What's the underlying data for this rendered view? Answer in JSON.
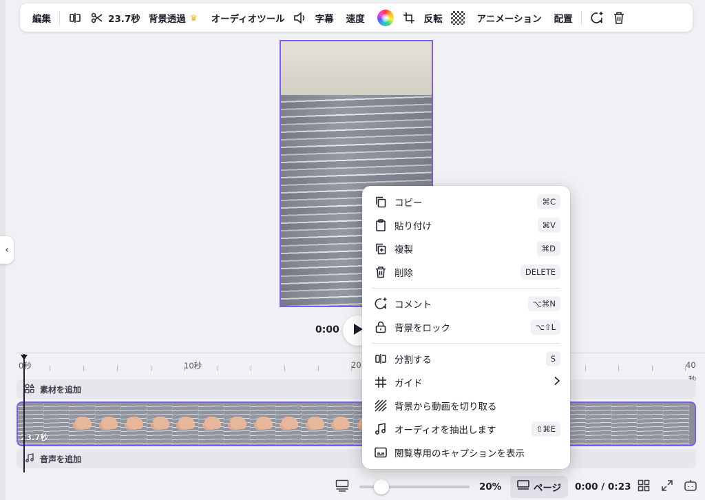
{
  "toolbar": {
    "edit": "編集",
    "duration": "23.7秒",
    "bg_remove": "背景透過",
    "audio_tools": "オーディオツール",
    "captions": "字幕",
    "speed": "速度",
    "flip": "反転",
    "animation": "アニメーション",
    "arrange": "配置"
  },
  "playback": {
    "current_time": "0:00"
  },
  "timeline": {
    "ruler": [
      "0秒",
      "10秒",
      "20",
      "40",
      "秒"
    ],
    "add_element": "素材を追加",
    "add_audio": "音声を追加",
    "clip_duration": "23.7秒"
  },
  "bottom": {
    "zoom": "20%",
    "zoom_fraction": 0.2,
    "page": "ページ",
    "time": "0:00 / 0:23"
  },
  "context_menu": {
    "copy": {
      "label": "コピー",
      "shortcut": "⌘C"
    },
    "paste": {
      "label": "貼り付け",
      "shortcut": "⌘V"
    },
    "duplicate": {
      "label": "複製",
      "shortcut": "⌘D"
    },
    "delete": {
      "label": "削除",
      "shortcut": "DELETE"
    },
    "comment": {
      "label": "コメント",
      "shortcut": "⌥⌘N"
    },
    "lock_bg": {
      "label": "背景をロック",
      "shortcut": "⌥⇧L"
    },
    "split": {
      "label": "分割する",
      "shortcut": "S"
    },
    "guide": {
      "label": "ガイド"
    },
    "cut_from_bg": {
      "label": "背景から動画を切り取る"
    },
    "extract_audio": {
      "label": "オーディオを抽出します",
      "shortcut": "⇧⌘E"
    },
    "show_captions": {
      "label": "閲覧専用のキャプションを表示"
    }
  },
  "colors": {
    "accent": "#7d5cf3",
    "background": "#f0f1f4"
  }
}
